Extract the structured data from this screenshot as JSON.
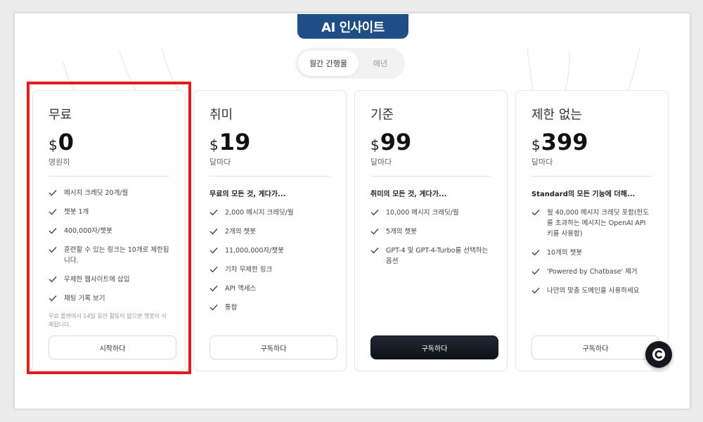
{
  "banner": {
    "text": "AI 인사이트"
  },
  "billing_toggle": {
    "monthly": "월간 간행물",
    "yearly": "매년"
  },
  "plans": [
    {
      "name": "무료",
      "currency": "$",
      "price": "0",
      "period": "영원히",
      "subhead": "",
      "features": [
        "메시지 크레딧 20개/월",
        "챗봇 1개",
        "400,000자/챗봇",
        "훈련할 수 있는 링크는 10개로 제한됩니다.",
        "무제한 웹사이트에 삽입",
        "채팅 기록 보기"
      ],
      "note": "무료 플랜에서 14일 동안 활동이 없으면 챗봇이 삭제됩니다.",
      "button": "시작하다"
    },
    {
      "name": "취미",
      "currency": "$",
      "price": "19",
      "period": "달마다",
      "subhead": "무료의 모든 것, 게다가...",
      "features": [
        "2,000 메시지 크레딧/월",
        "2개의 챗봇",
        "11,000,000자/챗봇",
        "기차 무제한 링크",
        "API 액세스",
        "통합"
      ],
      "note": "",
      "button": "구독하다"
    },
    {
      "name": "기준",
      "currency": "$",
      "price": "99",
      "period": "달마다",
      "subhead": "취미의 모든 것, 게다가...",
      "features": [
        "10,000 메시지 크레딧/월",
        "5개의 챗봇",
        "GPT-4 및 GPT-4-Turbo를 선택하는 옵션"
      ],
      "note": "",
      "button": "구독하다"
    },
    {
      "name": "제한 없는",
      "currency": "$",
      "price": "399",
      "period": "달마다",
      "subhead": "Standard의 모든 기능에 더해...",
      "features": [
        "월 40,000 메시지 크레딧 포함(한도를 초과하는 메시지는 OpenAI API 키를 사용함)",
        "10개의 챗봇",
        "'Powered by Chatbase' 제거",
        "나만의 맞춤 도메인을 사용하세요"
      ],
      "note": "",
      "button": "구독하다"
    }
  ],
  "colors": {
    "banner": "#1f4d86",
    "highlight": "#e41b1b",
    "dark_button": "#111520"
  },
  "icons": {
    "check": "check-icon",
    "chat": "chat-widget-icon"
  }
}
